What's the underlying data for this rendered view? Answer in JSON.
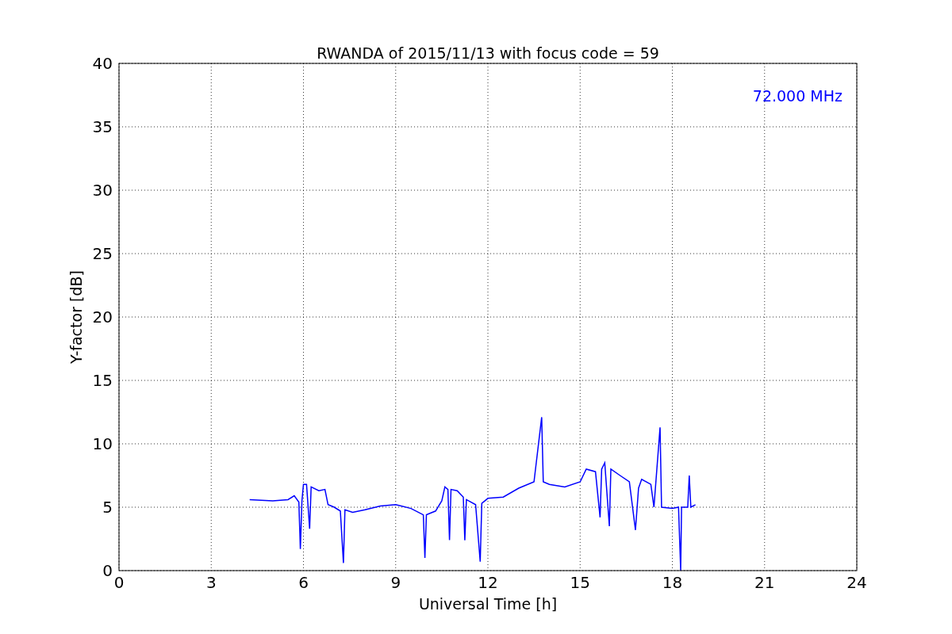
{
  "chart_data": {
    "type": "line",
    "title": "RWANDA of 2015/11/13 with focus code = 59",
    "xlabel": "Universal Time [h]",
    "ylabel": "Y-factor [dB]",
    "xlim": [
      0,
      24
    ],
    "ylim": [
      0,
      40
    ],
    "xticks": [
      0,
      3,
      6,
      9,
      12,
      15,
      18,
      21,
      24
    ],
    "yticks": [
      0,
      5,
      10,
      15,
      20,
      25,
      30,
      35,
      40
    ],
    "x": [
      4.25,
      5.0,
      5.5,
      5.7,
      5.85,
      5.9,
      5.95,
      6.0,
      6.1,
      6.2,
      6.25,
      6.5,
      6.7,
      6.8,
      7.0,
      7.2,
      7.3,
      7.35,
      7.6,
      8.0,
      8.5,
      9.0,
      9.5,
      9.9,
      9.95,
      10.0,
      10.3,
      10.5,
      10.6,
      10.7,
      10.75,
      10.8,
      11.0,
      11.2,
      11.25,
      11.3,
      11.6,
      11.75,
      11.8,
      12.0,
      12.5,
      13.0,
      13.5,
      13.75,
      13.8,
      14.0,
      14.5,
      15.0,
      15.2,
      15.5,
      15.65,
      15.7,
      15.8,
      15.95,
      16.0,
      16.3,
      16.6,
      16.8,
      16.9,
      17.0,
      17.3,
      17.4,
      17.6,
      17.65,
      18.0,
      18.2,
      18.27,
      18.3,
      18.5,
      18.55,
      18.6,
      18.75
    ],
    "grid": true,
    "series": [
      {
        "name": "72.000 MHz",
        "color": "#0000ff",
        "values": [
          5.6,
          5.5,
          5.6,
          5.9,
          5.4,
          1.7,
          5.5,
          6.8,
          6.8,
          3.3,
          6.6,
          6.3,
          6.4,
          5.2,
          5.0,
          4.7,
          0.6,
          4.8,
          4.6,
          4.8,
          5.1,
          5.2,
          4.9,
          4.4,
          1.0,
          4.4,
          4.7,
          5.5,
          6.6,
          6.4,
          2.4,
          6.4,
          6.3,
          5.8,
          2.4,
          5.6,
          5.2,
          0.7,
          5.3,
          5.7,
          5.8,
          6.5,
          7.0,
          12.1,
          7.0,
          6.8,
          6.6,
          7.0,
          8.0,
          7.8,
          4.2,
          8.0,
          8.5,
          3.5,
          8.0,
          7.5,
          7.0,
          3.2,
          6.5,
          7.2,
          6.8,
          5.0,
          11.3,
          5.0,
          4.9,
          5.0,
          0,
          5.0,
          5.0,
          7.5,
          5.0,
          5.2
        ]
      }
    ]
  }
}
